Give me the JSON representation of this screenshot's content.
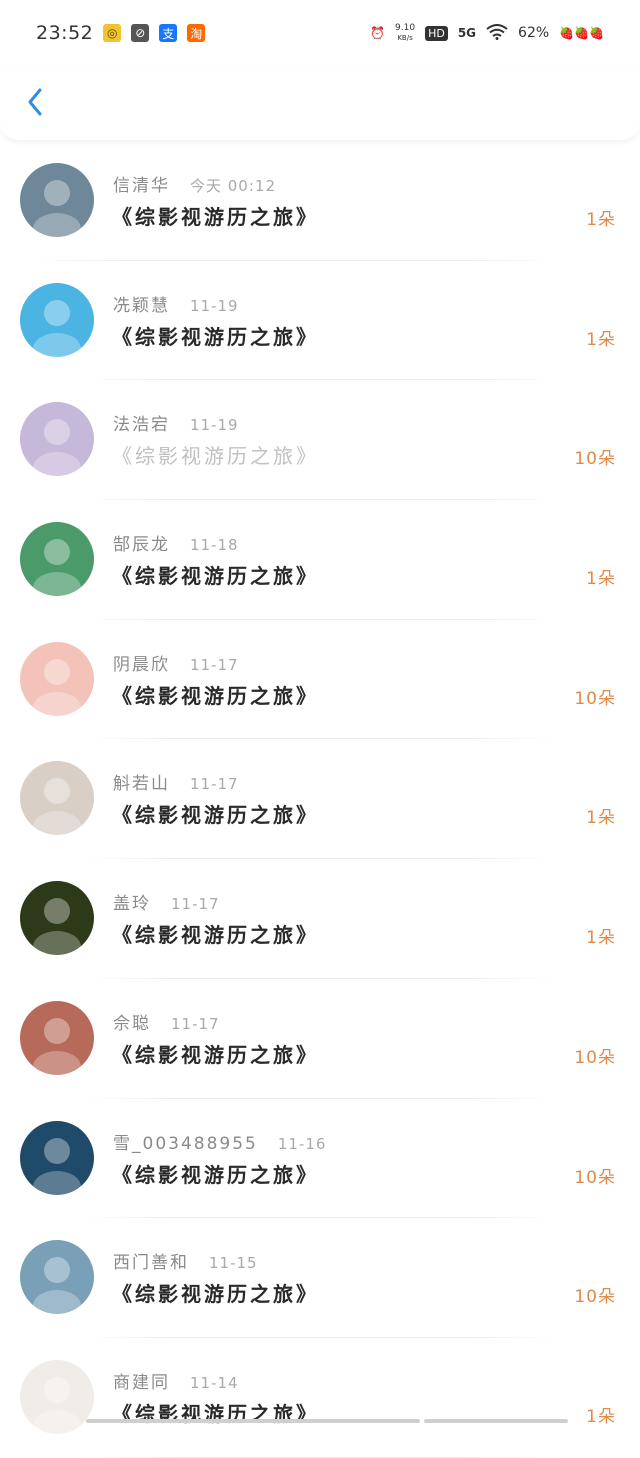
{
  "status_bar": {
    "time": "23:52",
    "app_icons": [
      "wechat-icon",
      "browser-icon",
      "alipay-icon",
      "taobao-icon"
    ],
    "app_glyphs": [
      "◎",
      "⊘",
      "支",
      "淘"
    ],
    "net_speed": "9.10",
    "net_unit": "KB/s",
    "hd": "HD",
    "signal": "5G",
    "battery_percent": "62%"
  },
  "header": {
    "back_label": "<"
  },
  "rows": [
    {
      "name": "信清华",
      "date": "今天 00:12",
      "title": "《综影视游历之旅》",
      "count": "1朵",
      "faded": false
    },
    {
      "name": "冼颖慧",
      "date": "11-19",
      "title": "《综影视游历之旅》",
      "count": "1朵",
      "faded": false
    },
    {
      "name": "法浩宕",
      "date": "11-19",
      "title": "《综影视游历之旅》",
      "count": "10朵",
      "faded": true
    },
    {
      "name": "郜辰龙",
      "date": "11-18",
      "title": "《综影视游历之旅》",
      "count": "1朵",
      "faded": false
    },
    {
      "name": "阴晨欣",
      "date": "11-17",
      "title": "《综影视游历之旅》",
      "count": "10朵",
      "faded": false
    },
    {
      "name": "斛若山",
      "date": "11-17",
      "title": "《综影视游历之旅》",
      "count": "1朵",
      "faded": false
    },
    {
      "name": "盖玲",
      "date": "11-17",
      "title": "《综影视游历之旅》",
      "count": "1朵",
      "faded": false
    },
    {
      "name": "佘聪",
      "date": "11-17",
      "title": "《综影视游历之旅》",
      "count": "10朵",
      "faded": false
    },
    {
      "name": "雪_003488955",
      "date": "11-16",
      "title": "《综影视游历之旅》",
      "count": "10朵",
      "faded": false
    },
    {
      "name": "西门善和",
      "date": "11-15",
      "title": "《综影视游历之旅》",
      "count": "10朵",
      "faded": false
    },
    {
      "name": "商建同",
      "date": "11-14",
      "title": "《综影视游历之旅》",
      "count": "1朵",
      "faded": false
    }
  ],
  "avatar_colors": [
    "#6f8899",
    "#4cb4e3",
    "#c6b8d9",
    "#4a9a6a",
    "#f3c3b9",
    "#d8cfc6",
    "#2d3a1a",
    "#b86a5a",
    "#1f4a6a",
    "#7aa0b8",
    "#f0ece8"
  ]
}
